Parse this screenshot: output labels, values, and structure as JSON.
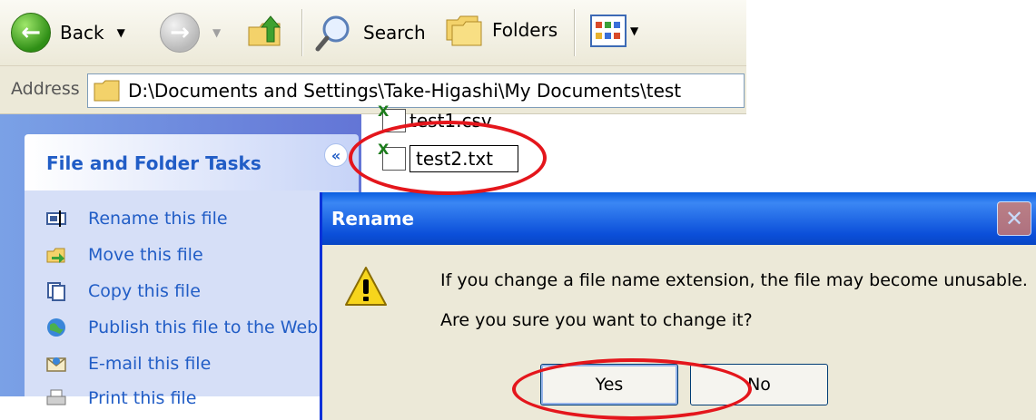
{
  "toolbar": {
    "back_label": "Back",
    "search_label": "Search",
    "folders_label": "Folders",
    "dropdown_glyph": "▼"
  },
  "address": {
    "label": "Address",
    "path": "D:\\Documents and Settings\\Take-Higashi\\My Documents\\test"
  },
  "tasks": {
    "title": "File and Folder Tasks",
    "collapse_glyph": "«",
    "items": [
      {
        "label": "Rename this file",
        "icon": "rename-icon"
      },
      {
        "label": "Move this file",
        "icon": "move-icon"
      },
      {
        "label": "Copy this file",
        "icon": "copy-icon"
      },
      {
        "label": "Publish this file to the Web",
        "icon": "publish-icon"
      },
      {
        "label": "E-mail this file",
        "icon": "email-icon"
      },
      {
        "label": "Print this file",
        "icon": "print-icon"
      }
    ]
  },
  "files": [
    {
      "name": "test1.csv"
    },
    {
      "name": "test2.txt",
      "renaming": true
    }
  ],
  "dialog": {
    "title": "Rename",
    "close_glyph": "✕",
    "message_line1": "If you change a file name extension, the file may become unusable.",
    "message_line2": "Are you sure you want to change it?",
    "yes_label": "Yes",
    "no_label": "No"
  },
  "colors": {
    "highlight": "#e4161c",
    "task_link": "#215dc6",
    "titlebar": "#0b4fd9"
  }
}
